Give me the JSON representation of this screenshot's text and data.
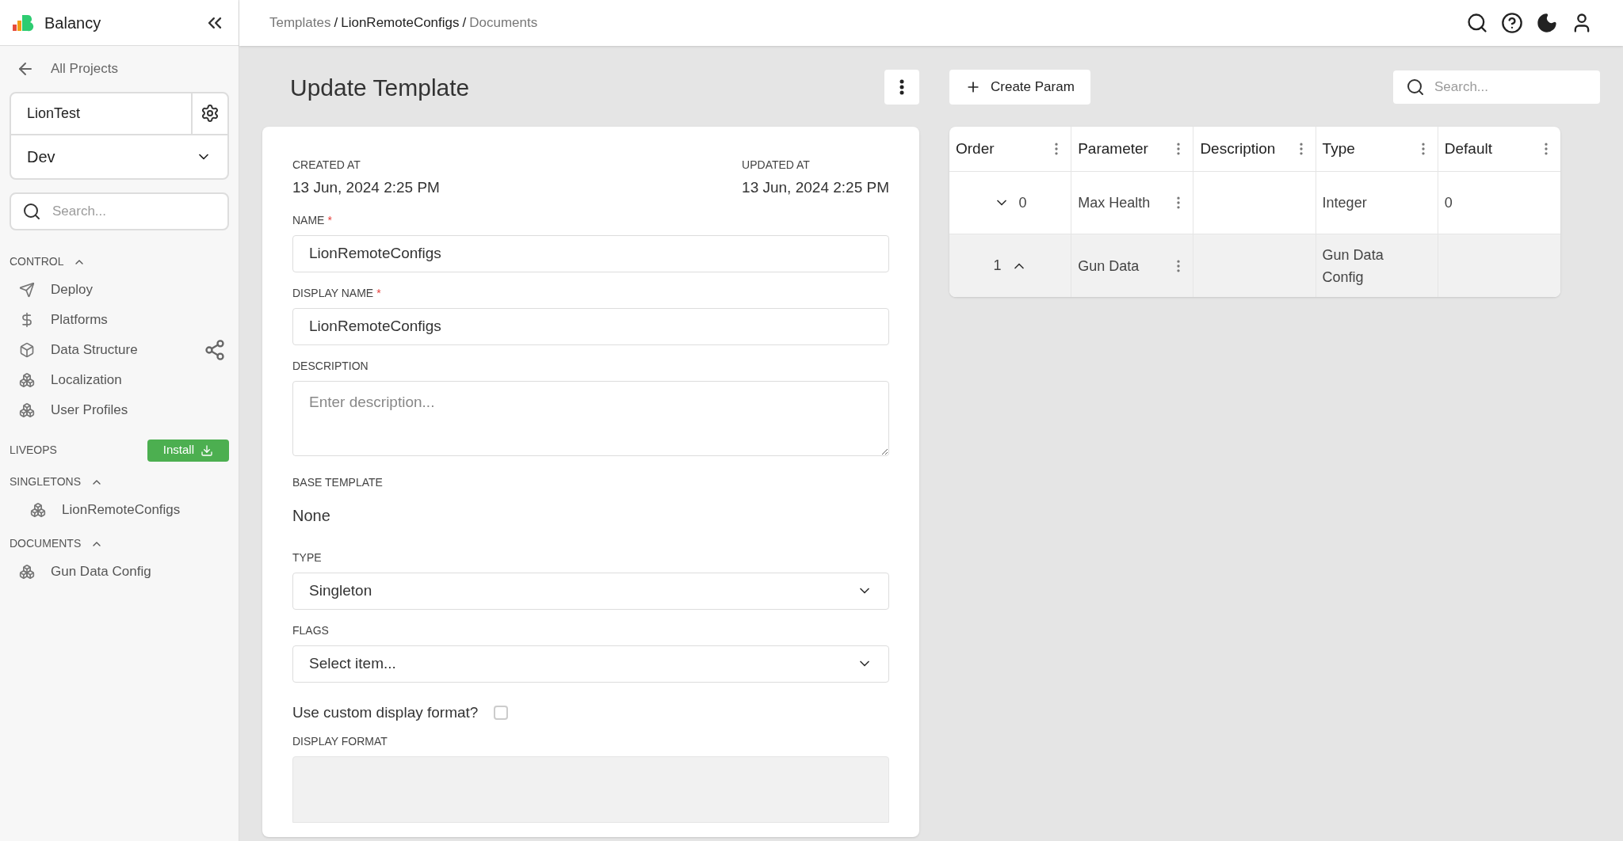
{
  "sidebar": {
    "app_name": "Balancy",
    "back_link": "All Projects",
    "project": "LionTest",
    "environment": "Dev",
    "search_placeholder": "Search...",
    "sections": [
      {
        "title": "CONTROL",
        "expanded": true,
        "items": [
          {
            "label": "Deploy",
            "kind": "plane"
          },
          {
            "label": "Platforms",
            "kind": "dollar"
          },
          {
            "label": "Data Structure",
            "kind": "box",
            "share": true
          },
          {
            "label": "Localization",
            "kind": "cubes"
          },
          {
            "label": "User Profiles",
            "kind": "cubes"
          }
        ]
      },
      {
        "title": "LIVEOPS",
        "button": "Install"
      },
      {
        "title": "SINGLETONS",
        "expanded": true,
        "indent": true,
        "items": [
          {
            "label": "LionRemoteConfigs",
            "kind": "cubes"
          }
        ]
      },
      {
        "title": "DOCUMENTS",
        "expanded": true,
        "items": [
          {
            "label": "Gun Data Config",
            "kind": "cubes"
          }
        ]
      }
    ]
  },
  "breadcrumb": {
    "separator": "/",
    "items": [
      {
        "label": "Templates",
        "current": false
      },
      {
        "label": "LionRemoteConfigs",
        "current": true
      },
      {
        "label": "Documents",
        "current": false
      }
    ]
  },
  "page_title": "Update Template",
  "form": {
    "created_label": "CREATED AT",
    "created": "13 Jun, 2024 2:25 PM",
    "updated_label": "UPDATED AT",
    "updated": "13 Jun, 2024 2:25 PM",
    "name_label": "NAME",
    "name": "LionRemoteConfigs",
    "display_name_label": "DISPLAY NAME",
    "display_name": "LionRemoteConfigs",
    "required_mark": "*",
    "description_label": "DESCRIPTION",
    "description_placeholder": "Enter description...",
    "base_template_label": "BASE TEMPLATE",
    "base_template": "None",
    "type_label": "TYPE",
    "type": "Singleton",
    "flags_label": "FLAGS",
    "flags_placeholder": "Select item...",
    "custom_format_label": "Use custom display format?",
    "custom_format_checked": false,
    "display_format_label": "DISPLAY FORMAT"
  },
  "create_param": "Create Param",
  "search_placeholder": "Search...",
  "table": {
    "columns": [
      "Order",
      "Parameter",
      "Description",
      "Type",
      "Default"
    ],
    "rows": [
      {
        "order": "0",
        "kind": "move_down",
        "parameter": "Max Health",
        "description": "",
        "type": "Integer",
        "default": "0",
        "selected": false
      },
      {
        "order": "1",
        "kind": "move_up",
        "parameter": "Gun Data",
        "description": "",
        "type": "Gun Data Config",
        "default": "",
        "selected": true
      }
    ]
  }
}
